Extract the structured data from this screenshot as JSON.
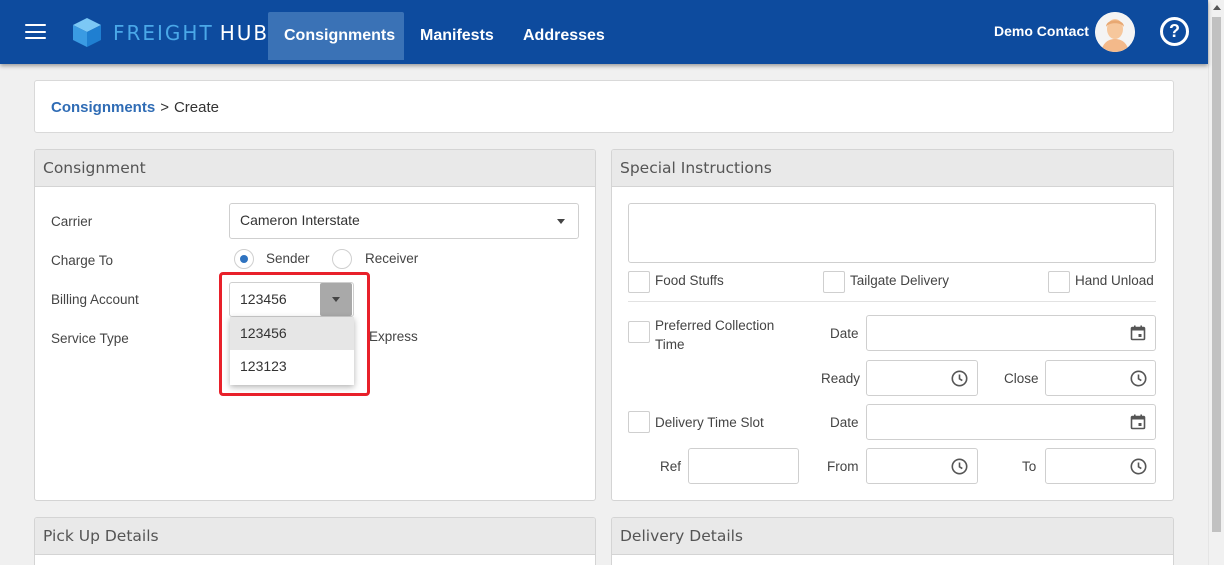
{
  "app": {
    "brand_light": "FREIGHT",
    "brand_bold": "HUB",
    "nav": [
      {
        "label": "Consignments",
        "active": true
      },
      {
        "label": "Manifests",
        "active": false
      },
      {
        "label": "Addresses",
        "active": false
      }
    ],
    "user_name": "Demo Contact",
    "help_glyph": "?",
    "colors": {
      "topbar": "#0d4b9e",
      "accent": "#2f6cb5",
      "highlight": "#e8202a"
    }
  },
  "breadcrumb": {
    "parent": "Consignments",
    "separator": ">",
    "current": "Create"
  },
  "consignment": {
    "title": "Consignment",
    "carrier_label": "Carrier",
    "carrier_value": "Cameron Interstate",
    "charge_to_label": "Charge To",
    "charge_to_options": [
      "Sender",
      "Receiver"
    ],
    "charge_to_selected": "Sender",
    "billing_account_label": "Billing Account",
    "billing_account_value": "123456",
    "billing_account_options": [
      "123456",
      "123123"
    ],
    "service_type_label": "Service Type",
    "service_type_visible_option": "Express"
  },
  "special_instructions": {
    "title": "Special Instructions",
    "options": [
      "Food Stuffs",
      "Tailgate Delivery",
      "Hand Unload"
    ],
    "preferred_collection": {
      "label": "Preferred Collection Time",
      "date_label": "Date",
      "ready_label": "Ready",
      "close_label": "Close"
    },
    "delivery_slot": {
      "label": "Delivery Time Slot",
      "date_label": "Date",
      "ref_label": "Ref",
      "from_label": "From",
      "to_label": "To"
    }
  },
  "pickup": {
    "title": "Pick Up Details"
  },
  "delivery": {
    "title": "Delivery Details"
  }
}
